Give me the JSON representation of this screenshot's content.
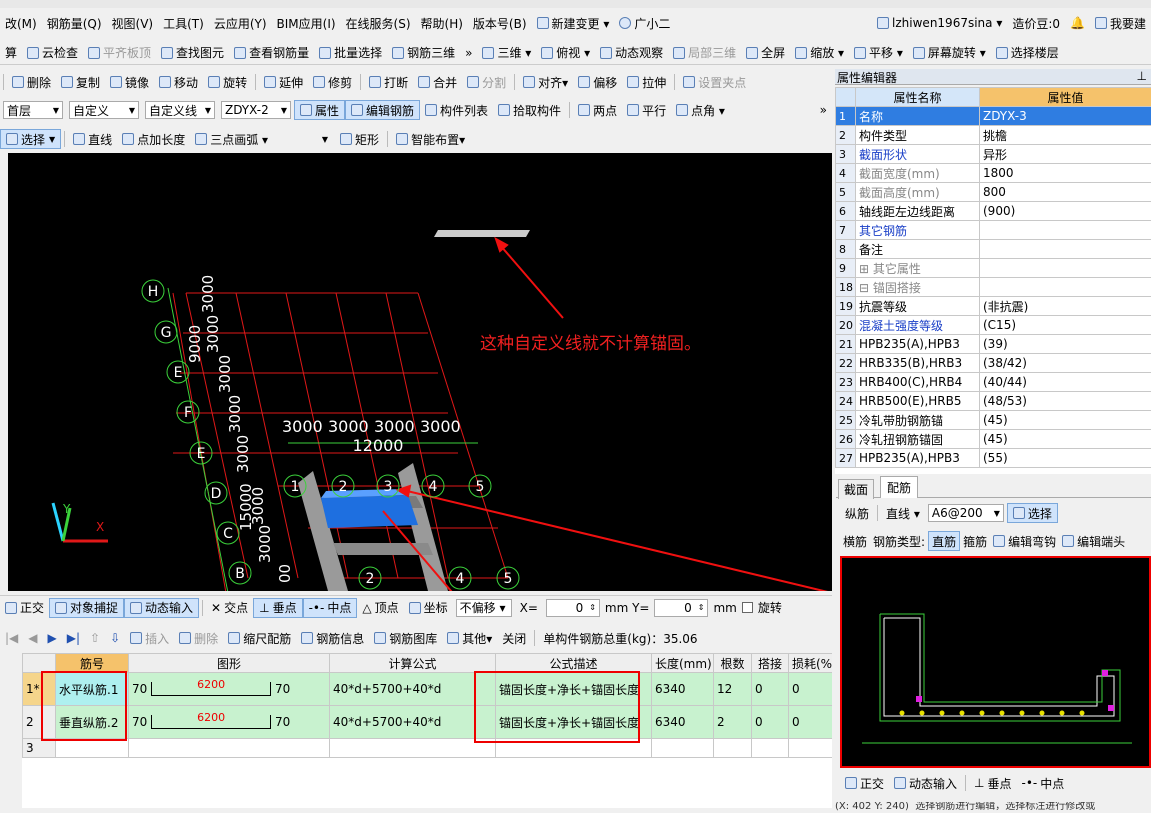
{
  "menu": [
    "改(M)",
    "钢筋量(Q)",
    "视图(V)",
    "工具(T)",
    "云应用(Y)",
    "BIM应用(I)",
    "在线服务(S)",
    "帮助(H)",
    "版本号(B)",
    "新建变更 ▾",
    "广小二"
  ],
  "user": {
    "name": "lzhiwen1967sina ▾",
    "coins": "造价豆:0",
    "ask": "我要建"
  },
  "toolbar1": [
    "算",
    "云检查",
    "平齐板顶",
    "查找图元",
    "查看钢筋量",
    "批量选择",
    "钢筋三维",
    "三维 ▾",
    "俯视 ▾",
    "动态观察",
    "局部三维",
    "全屏",
    "缩放 ▾",
    "平移 ▾",
    "屏幕旋转 ▾",
    "选择楼层"
  ],
  "toolbar2": [
    "删除",
    "复制",
    "镜像",
    "移动",
    "旋转",
    "延伸",
    "修剪",
    "打断",
    "合并",
    "分割",
    "对齐▾",
    "偏移",
    "拉伸",
    "设置夹点"
  ],
  "toolbar3": {
    "floor": "首层",
    "type": "自定义",
    "subtype": "自定义线",
    "component": "ZDYX-2",
    "buttons": [
      "属性",
      "编辑钢筋",
      "构件列表",
      "拾取构件",
      "两点",
      "平行",
      "点角 ▾"
    ]
  },
  "toolbar4": [
    "选择",
    "直线",
    "点加长度",
    "三点画弧 ▾",
    "矩形",
    "智能布置▾"
  ],
  "cad": {
    "annotation": "这种自定义线就不计算锚固。",
    "axis_rows": [
      "H",
      "G",
      "E",
      "F",
      "E",
      "D",
      "C",
      "B"
    ],
    "axis_cols": [
      "1",
      "2",
      "3",
      "4",
      "5"
    ],
    "dims_left": [
      "3000",
      "3000",
      "9000",
      "3000",
      "3000",
      "3000",
      "15000",
      "3000",
      "3000",
      "00"
    ],
    "dims_top": [
      "3000",
      "3000",
      "3000",
      "3000"
    ],
    "dim_total": "12000",
    "bottom_cols": [
      "2",
      "4",
      "5"
    ]
  },
  "snapbar": {
    "items": [
      "正交",
      "对象捕捉",
      "动态输入",
      "交点",
      "垂点",
      "中点",
      "顶点",
      "坐标"
    ],
    "offset": "不偏移 ▾",
    "x_label": "X=",
    "x_val": "0",
    "y_label": "mm Y=",
    "y_val": "0",
    "unit": "mm",
    "rotate": "旋转"
  },
  "rebar_toolbar": {
    "items": [
      "插入",
      "删除",
      "缩尺配筋",
      "钢筋信息",
      "钢筋图库",
      "其他▾",
      "关闭"
    ],
    "total": "单构件钢筋总重(kg)：35.06"
  },
  "rebar_table": {
    "headers": [
      "筋号",
      "图形",
      "计算公式",
      "公式描述",
      "长度(mm)",
      "根数",
      "搭接",
      "损耗(%"
    ],
    "rows": [
      {
        "idx": "1*",
        "name": "水平纵筋.1",
        "l": "70",
        "mid": "6200",
        "r": "70",
        "formula": "40*d+5700+40*d",
        "desc": "锚固长度+净长+锚固长度",
        "len": "6340",
        "count": "12",
        "lap": "0",
        "loss": "0"
      },
      {
        "idx": "2",
        "name": "垂直纵筋.2",
        "l": "70",
        "mid": "6200",
        "r": "70",
        "formula": "40*d+5700+40*d",
        "desc": "锚固长度+净长+锚固长度",
        "len": "6340",
        "count": "2",
        "lap": "0",
        "loss": "0"
      },
      {
        "idx": "3",
        "name": "",
        "l": "",
        "mid": "",
        "r": "",
        "formula": "",
        "desc": "",
        "len": "",
        "count": "",
        "lap": "",
        "loss": ""
      }
    ]
  },
  "props": {
    "title": "属性编辑器",
    "headers": [
      "属性名称",
      "属性值"
    ],
    "rows": [
      {
        "n": "1",
        "k": "名称",
        "v": "ZDYX-3",
        "c": "blue"
      },
      {
        "n": "2",
        "k": "构件类型",
        "v": "挑檐",
        "c": ""
      },
      {
        "n": "3",
        "k": "截面形状",
        "v": "异形",
        "c": "blue"
      },
      {
        "n": "4",
        "k": "截面宽度(mm)",
        "v": "1800",
        "c": "gray"
      },
      {
        "n": "5",
        "k": "截面高度(mm)",
        "v": "800",
        "c": "gray"
      },
      {
        "n": "6",
        "k": "轴线距左边线距离",
        "v": "(900)",
        "c": ""
      },
      {
        "n": "7",
        "k": "其它钢筋",
        "v": "",
        "c": "blue"
      },
      {
        "n": "8",
        "k": "备注",
        "v": "",
        "c": ""
      },
      {
        "n": "9",
        "k": "⊞ 其它属性",
        "v": "",
        "c": "gray"
      },
      {
        "n": "18",
        "k": "⊟ 锚固搭接",
        "v": "",
        "c": "gray"
      },
      {
        "n": "19",
        "k": "  抗震等级",
        "v": "(非抗震)",
        "c": ""
      },
      {
        "n": "20",
        "k": "  混凝土强度等级",
        "v": "(C15)",
        "c": "blue"
      },
      {
        "n": "21",
        "k": "  HPB235(A),HPB3",
        "v": "(39)",
        "c": ""
      },
      {
        "n": "22",
        "k": "  HRB335(B),HRB3",
        "v": "(38/42)",
        "c": ""
      },
      {
        "n": "23",
        "k": "  HRB400(C),HRB4",
        "v": "(40/44)",
        "c": ""
      },
      {
        "n": "24",
        "k": "  HRB500(E),HRB5",
        "v": "(48/53)",
        "c": ""
      },
      {
        "n": "25",
        "k": "  冷轧带肋钢筋锚",
        "v": "(45)",
        "c": ""
      },
      {
        "n": "26",
        "k": "  冷轧扭钢筋锚固",
        "v": "(45)",
        "c": ""
      },
      {
        "n": "27",
        "k": "  HPB235(A),HPB3",
        "v": "(55)",
        "c": ""
      }
    ]
  },
  "tabs": [
    "截面",
    "配筋"
  ],
  "section_bar1": {
    "label": "纵筋",
    "type": "直线 ▾",
    "spec": "A6@200",
    "select": "选择"
  },
  "section_bar2": [
    "横筋",
    "钢筋类型:",
    "直筋",
    "箍筋",
    "编辑弯钩",
    "编辑端头"
  ],
  "section_bottom": [
    "正交",
    "动态输入",
    "垂点",
    "中点"
  ],
  "statusbar": {
    "coords": "(X: 402 Y: 240)",
    "hint": "选择钢筋进行编辑，选择标注进行修改或"
  }
}
